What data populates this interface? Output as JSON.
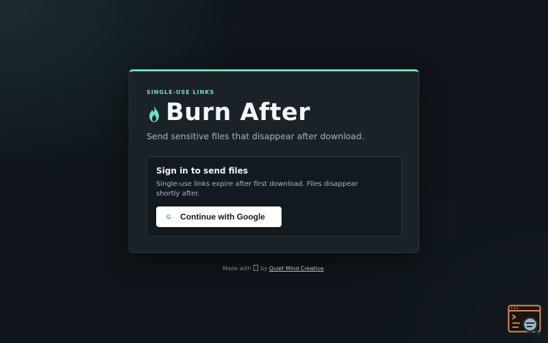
{
  "card": {
    "eyebrow": "SINGLE-USE LINKS",
    "title": "Burn After",
    "subtitle": "Send sensitive files that disappear after download.",
    "accent_color": "#6fe0bd",
    "title_icon": "flame-icon"
  },
  "signin": {
    "title": "Sign in to send files",
    "description": "Single-use links expire after first download. Files disappear shortly after.",
    "google_icon_letter": "G",
    "google_button_label": "Continue with Google"
  },
  "footer": {
    "prefix": "Made with",
    "by": "by",
    "link_label": "Quiet Mind Creative",
    "suffix": "."
  },
  "corner_widget": {
    "icon": "terminal-search-icon"
  }
}
